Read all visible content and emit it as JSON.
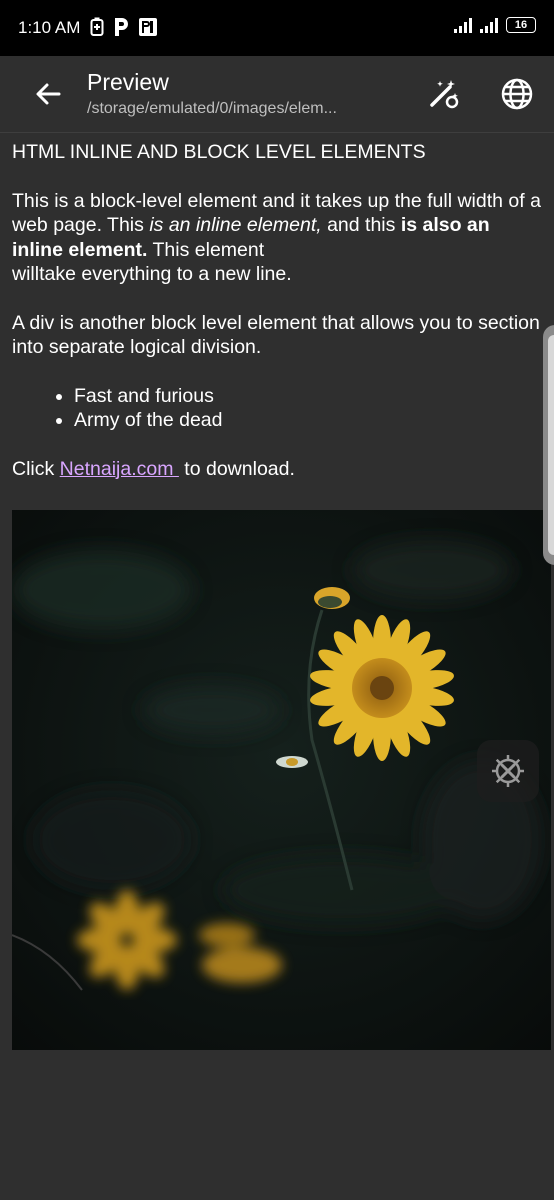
{
  "status_bar": {
    "time": "1:10 AM",
    "battery": "16",
    "icons": [
      "battery-saver-icon",
      "p-app-icon",
      "pi-app-icon",
      "signal-icon",
      "signal-icon",
      "battery-icon"
    ]
  },
  "app_bar": {
    "title": "Preview",
    "subtitle": "/storage/emulated/0/images/elem...",
    "back_icon": "back-arrow-icon",
    "actions": [
      "magic-wand-icon",
      "globe-icon"
    ]
  },
  "document": {
    "heading": "HTML INLINE AND BLOCK LEVEL ELEMENTS",
    "p1_part1": "This is a block-level element and it takes up the full width of a web page. This ",
    "p1_italic": "is an inline element,",
    "p1_part2": " and this ",
    "p1_bold": "is also an inline element.",
    "p1_part3": " This element",
    "p1_line2": "willtake everything to a new line.",
    "p2": "A div is another block level element that allows you to section into separate logical division.",
    "list": [
      "Fast and furious",
      "Army of the dead"
    ],
    "click_prefix": "Click ",
    "link_text": "Netnaija.com ",
    "click_suffix": " to download."
  },
  "colors": {
    "background": "#2f2f2f",
    "status_bar": "#000000",
    "link": "#d9a6ff",
    "flower": "#e3b62a"
  },
  "floating": {
    "settings_icon": "settings-tools-icon"
  }
}
